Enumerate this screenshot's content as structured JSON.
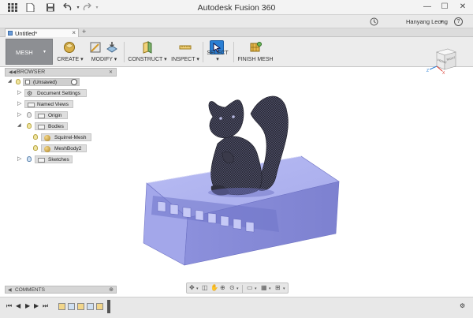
{
  "app": {
    "title": "Autodesk Fusion 360",
    "user": "Hanyang Leong",
    "user_caret": "▾",
    "help": "?",
    "minimize": "—",
    "maximize": "☐",
    "close": "✕"
  },
  "tab": {
    "label": "Untitled*",
    "close": "×",
    "plus": "+"
  },
  "toolbar": {
    "workspace": "MESH",
    "workspace_caret": "▾",
    "groups": [
      {
        "label": "CREATE ▾"
      },
      {
        "label": "MODIFY ▾"
      },
      {
        "label": "CONSTRUCT ▾"
      },
      {
        "label": "INSPECT ▾"
      },
      {
        "label": "SELECT ▾"
      },
      {
        "label": "FINISH MESH"
      }
    ]
  },
  "browser": {
    "header": "BROWSER",
    "items": [
      {
        "label": "(Unsaved)"
      },
      {
        "label": "Document Settings"
      },
      {
        "label": "Named Views"
      },
      {
        "label": "Origin"
      },
      {
        "label": "Bodies"
      },
      {
        "label": "Squirrel-Mesh"
      },
      {
        "label": "MeshBody2"
      },
      {
        "label": "Sketches"
      }
    ]
  },
  "comments": {
    "label": "COMMENTS"
  },
  "viewcube": {
    "front": "FRONT",
    "right": "RIGHT",
    "axis_z": "Z",
    "axis_x": "X"
  },
  "colors": {
    "accent": "#2a7fd4",
    "mesh_body": "#9a9de6",
    "squirrel": "#2b2b38",
    "workspace_btn": "#8d8f93"
  }
}
